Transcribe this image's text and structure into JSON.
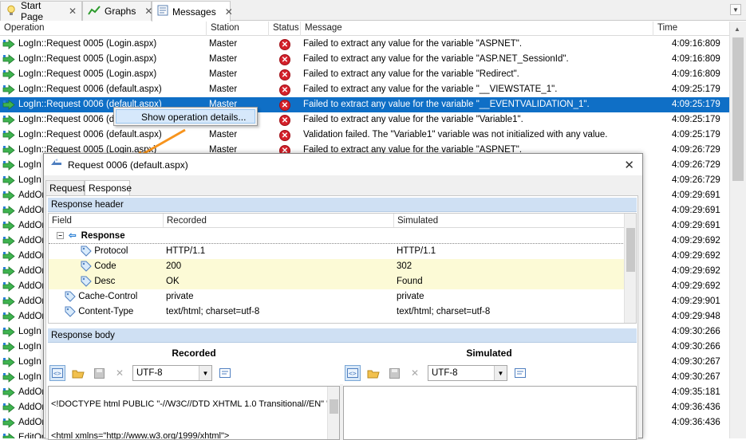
{
  "tabs": [
    {
      "label": "Start Page",
      "icon": "lightbulb-icon",
      "active": false
    },
    {
      "label": "Graphs",
      "icon": "graph-icon",
      "active": false
    },
    {
      "label": "Messages",
      "icon": "messages-icon",
      "active": true
    }
  ],
  "grid": {
    "columns": [
      "Operation",
      "Station",
      "Status",
      "Message",
      "Time"
    ],
    "rows": [
      {
        "op": "LogIn::Request 0005 (Login.aspx)",
        "station": "Master",
        "msg": "Failed to extract any value for the variable \"ASPNET\".",
        "time": "4:09:16:809"
      },
      {
        "op": "LogIn::Request 0005 (Login.aspx)",
        "station": "Master",
        "msg": "Failed to extract any value for the variable \"ASP.NET_SessionId\".",
        "time": "4:09:16:809"
      },
      {
        "op": "LogIn::Request 0005 (Login.aspx)",
        "station": "Master",
        "msg": "Failed to extract any value for the variable \"Redirect\".",
        "time": "4:09:16:809"
      },
      {
        "op": "LogIn::Request 0006 (default.aspx)",
        "station": "Master",
        "msg": "Failed to extract any value for the variable \"__VIEWSTATE_1\".",
        "time": "4:09:25:179"
      },
      {
        "op": "LogIn::Request 0006 (default.aspx)",
        "station": "Master",
        "msg": "Failed to extract any value for the variable \"__EVENTVALIDATION_1\".",
        "time": "4:09:25:179"
      },
      {
        "op": "LogIn::Request 0006 (d",
        "station": "",
        "msg": "Failed to extract any value for the variable \"Variable1\".",
        "time": "4:09:25:179"
      },
      {
        "op": "LogIn::Request 0006 (default.aspx)",
        "station": "Master",
        "msg": "Validation failed. The \"Variable1\" variable was not initialized with any value.",
        "time": "4:09:25:179"
      },
      {
        "op": "LogIn::Request 0005 (Login.aspx)",
        "station": "Master",
        "msg": "Failed to extract any value for the variable \"ASPNET\".",
        "time": "4:09:26:729"
      },
      {
        "op": "LogIn",
        "station": "",
        "msg": "",
        "time": "4:09:26:729"
      },
      {
        "op": "LogIn",
        "station": "",
        "msg": "",
        "time": "4:09:26:729"
      },
      {
        "op": "AddOr",
        "station": "",
        "msg": "",
        "time": "4:09:29:691"
      },
      {
        "op": "AddOr",
        "station": "",
        "msg": "",
        "time": "4:09:29:691"
      },
      {
        "op": "AddOr",
        "station": "",
        "msg": "",
        "time": "4:09:29:691"
      },
      {
        "op": "AddOr",
        "station": "",
        "msg": "",
        "time": "4:09:29:692"
      },
      {
        "op": "AddOr",
        "station": "",
        "msg": "",
        "time": "4:09:29:692"
      },
      {
        "op": "AddOr",
        "station": "",
        "msg": "",
        "time": "4:09:29:692"
      },
      {
        "op": "AddOr",
        "station": "",
        "msg": "",
        "time": "4:09:29:692"
      },
      {
        "op": "AddOr",
        "station": "",
        "msg": "",
        "time": "4:09:29:901"
      },
      {
        "op": "AddOr",
        "station": "",
        "msg": "",
        "time": "4:09:29:948"
      },
      {
        "op": "LogIn",
        "station": "",
        "msg": "",
        "time": "4:09:30:266"
      },
      {
        "op": "LogIn",
        "station": "",
        "msg": "",
        "time": "4:09:30:266"
      },
      {
        "op": "LogIn",
        "station": "",
        "msg": "",
        "time": "4:09:30:267"
      },
      {
        "op": "LogIn",
        "station": "",
        "msg": "",
        "time": "4:09:30:267"
      },
      {
        "op": "AddOr",
        "station": "",
        "msg": "",
        "time": "4:09:35:181"
      },
      {
        "op": "AddOr",
        "station": "",
        "msg": "",
        "time": "4:09:36:436"
      },
      {
        "op": "AddOr",
        "station": "",
        "msg": "",
        "time": "4:09:36:436"
      },
      {
        "op": "EditOr",
        "station": "",
        "msg": "",
        "time": ""
      }
    ]
  },
  "context_menu": {
    "item": "Show operation details..."
  },
  "dialog": {
    "title": "Request 0006 (default.aspx)",
    "tabs": [
      "Request",
      "Response"
    ],
    "response_header_label": "Response header",
    "header_columns": [
      "Field",
      "Recorded",
      "Simulated"
    ],
    "header_rows": [
      {
        "field": "Response",
        "recorded": "",
        "simulated": "",
        "group": true
      },
      {
        "field": "Protocol",
        "recorded": "HTTP/1.1",
        "simulated": "HTTP/1.1"
      },
      {
        "field": "Code",
        "recorded": "200",
        "simulated": "302",
        "diff": true
      },
      {
        "field": "Desc",
        "recorded": "OK",
        "simulated": "Found",
        "diff": true
      },
      {
        "field": "Cache-Control",
        "recorded": "private",
        "simulated": "private"
      },
      {
        "field": "Content-Type",
        "recorded": "text/html; charset=utf-8",
        "simulated": "text/html; charset=utf-8"
      }
    ],
    "response_body_label": "Response body",
    "recorded_label": "Recorded",
    "simulated_label": "Simulated",
    "encoding": "UTF-8",
    "body_text": "<!DOCTYPE html PUBLIC \"-//W3C//DTD XHTML 1.0 Transitional//EN\" \"ht\n\n<html xmlns=\"http://www.w3.org/1999/xhtml\">"
  },
  "colors": {
    "selection": "#0f6fc6",
    "error": "#d4202a",
    "diff_row": "#fcfad6",
    "section_header": "#cfe0f3",
    "callout_arrow": "#f7941d"
  }
}
